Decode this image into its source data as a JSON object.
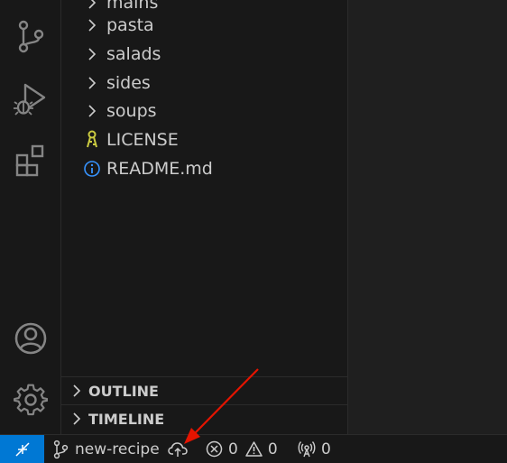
{
  "activity_bar": {
    "icons": [
      "source-control-icon",
      "run-debug-icon",
      "extensions-icon",
      "account-icon",
      "settings-gear-icon"
    ]
  },
  "explorer": {
    "items": [
      {
        "label": "mains",
        "kind": "folder"
      },
      {
        "label": "pasta",
        "kind": "folder"
      },
      {
        "label": "salads",
        "kind": "folder"
      },
      {
        "label": "sides",
        "kind": "folder"
      },
      {
        "label": "soups",
        "kind": "folder"
      },
      {
        "label": "LICENSE",
        "kind": "license-file"
      },
      {
        "label": "README.md",
        "kind": "info-file"
      }
    ],
    "sections": [
      {
        "label": "OUTLINE"
      },
      {
        "label": "TIMELINE"
      }
    ]
  },
  "status_bar": {
    "branch": "new-recipe",
    "errors": "0",
    "warnings": "0",
    "ports": "0"
  },
  "colors": {
    "remote_bg": "#0078d4",
    "license_icon": "#cbcb41",
    "info_icon": "#3794ff",
    "annotation_arrow": "#e51400"
  }
}
